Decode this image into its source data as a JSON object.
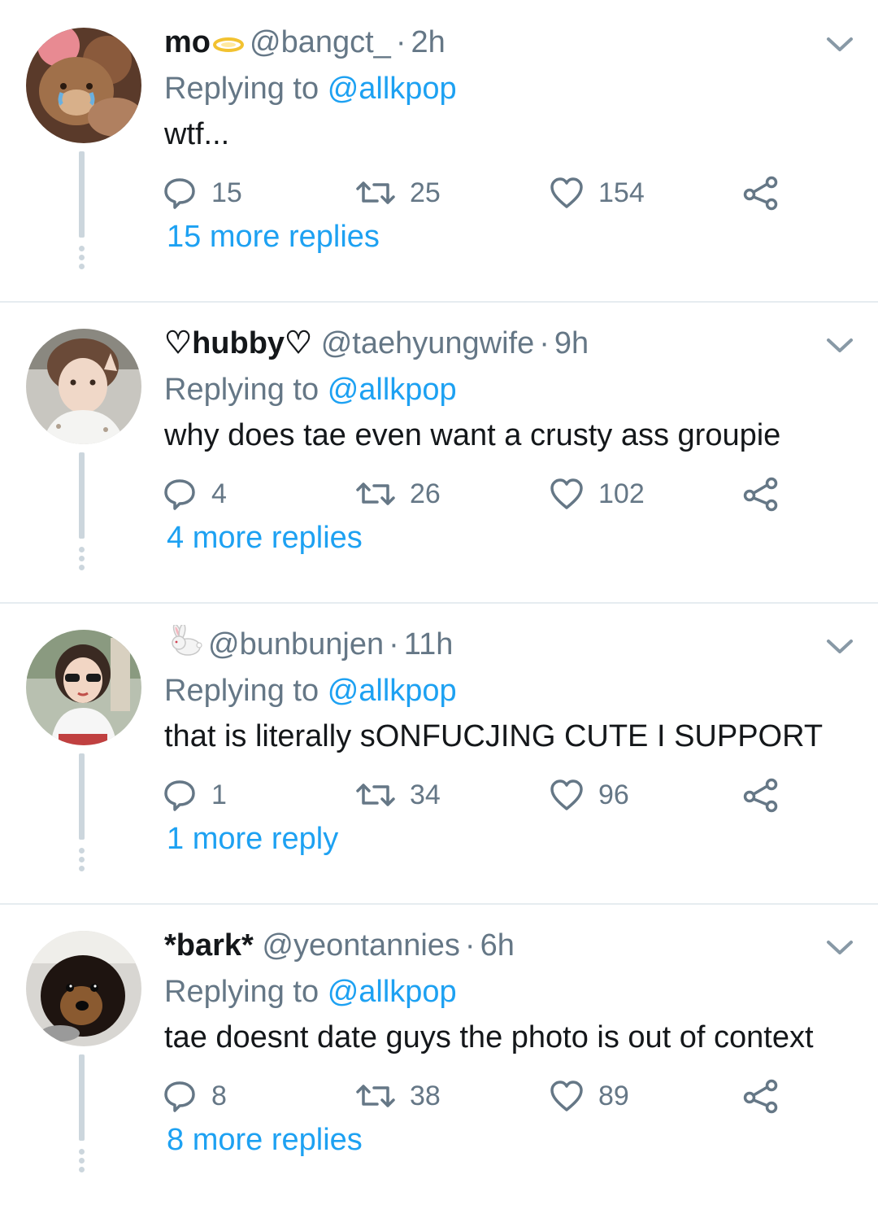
{
  "colors": {
    "link": "#1da1f2",
    "muted": "#657786",
    "text": "#14171a",
    "divider": "#e6ecf0",
    "thread": "#ccd6dd"
  },
  "tweets": [
    {
      "display_name": "mo",
      "name_emoji": "halo-icon",
      "handle": "@bangct_",
      "time": "2h",
      "replying_prefix": "Replying to",
      "replying_handle": "@allkpop",
      "text": "wtf...",
      "replies": "15",
      "retweets": "25",
      "likes": "154",
      "more_replies": "15 more replies"
    },
    {
      "display_name": "♡hubby♡",
      "name_emoji": "",
      "handle": "@taehyungwife",
      "time": "9h",
      "replying_prefix": "Replying to",
      "replying_handle": "@allkpop",
      "text": "why does tae even want a crusty ass groupie",
      "replies": "4",
      "retweets": "26",
      "likes": "102",
      "more_replies": "4 more replies"
    },
    {
      "display_name": "",
      "name_emoji": "rabbit-icon",
      "handle": "@bunbunjen",
      "time": "11h",
      "replying_prefix": "Replying to",
      "replying_handle": "@allkpop",
      "text": "that is literally sONFUCJING CUTE I SUPPORT",
      "replies": "1",
      "retweets": "34",
      "likes": "96",
      "more_replies": "1 more reply"
    },
    {
      "display_name": "*bark*",
      "name_emoji": "",
      "handle": "@yeontannies",
      "time": "6h",
      "replying_prefix": "Replying to",
      "replying_handle": "@allkpop",
      "text": "tae doesnt date guys the photo is out of context",
      "replies": "8",
      "retweets": "38",
      "likes": "89",
      "more_replies": "8 more replies"
    }
  ]
}
